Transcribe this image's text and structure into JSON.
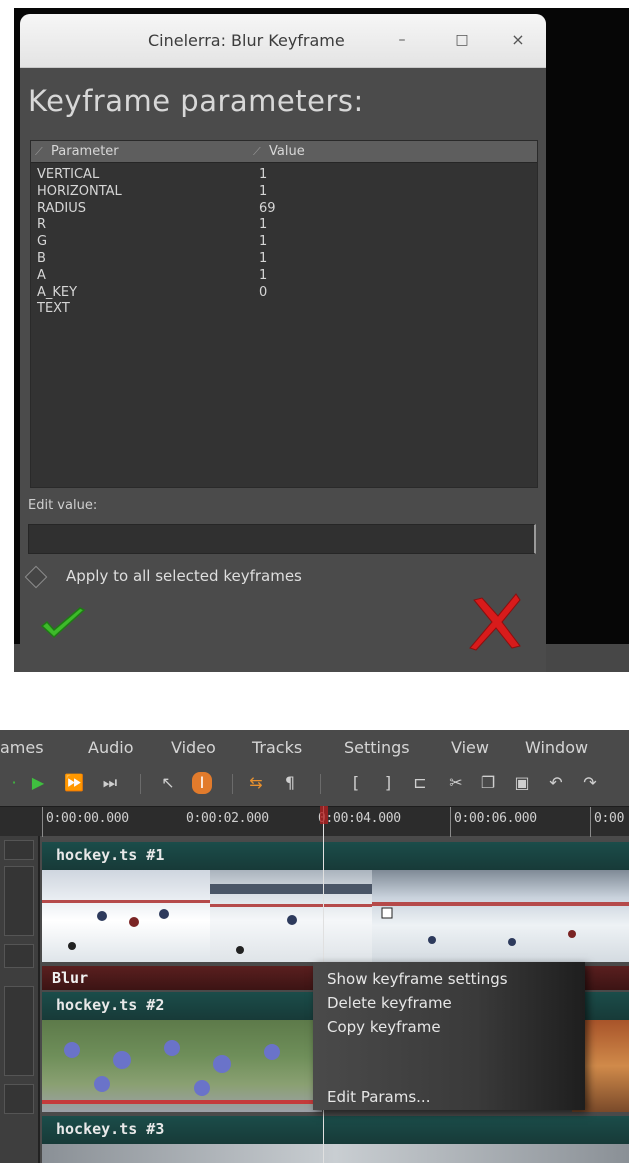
{
  "dialog": {
    "title": "Cinelerra: Blur Keyframe",
    "heading": "Keyframe parameters:",
    "columns": {
      "parameter": "Parameter",
      "value": "Value"
    },
    "rows": [
      {
        "name": "VERTICAL",
        "value": "1"
      },
      {
        "name": "HORIZONTAL",
        "value": "1"
      },
      {
        "name": "RADIUS",
        "value": "69"
      },
      {
        "name": "R",
        "value": "1"
      },
      {
        "name": "G",
        "value": "1"
      },
      {
        "name": "B",
        "value": "1"
      },
      {
        "name": "A",
        "value": "1"
      },
      {
        "name": "A_KEY",
        "value": "0"
      },
      {
        "name": "TEXT",
        "value": ""
      }
    ],
    "edit_label": "Edit value:",
    "edit_value": "",
    "apply_label": "Apply to all selected keyframes",
    "window_buttons": {
      "minimize": "–",
      "maximize": "□",
      "close": "×"
    }
  },
  "main": {
    "menus": [
      "ames",
      "Audio",
      "Video",
      "Tracks",
      "Settings",
      "View",
      "Window"
    ],
    "timecodes": [
      "0:00:00.000",
      "0:00:02.000",
      "0:00:04.000",
      "0:00:06.000",
      "0:00"
    ],
    "tracks": {
      "track1": "hockey.ts #1",
      "plugin": "Blur",
      "track2": "hockey.ts #2",
      "track3": "hockey.ts #3"
    },
    "context_menu": {
      "show": "Show keyframe settings",
      "delete": "Delete keyframe",
      "copy": "Copy keyframe",
      "edit": "Edit Params..."
    }
  },
  "colors": {
    "accent_ok": "#3dbb2a",
    "accent_cancel": "#d81b1b",
    "track_title": "#1b4d4a",
    "plugin_bar": "#5a1f1f"
  }
}
